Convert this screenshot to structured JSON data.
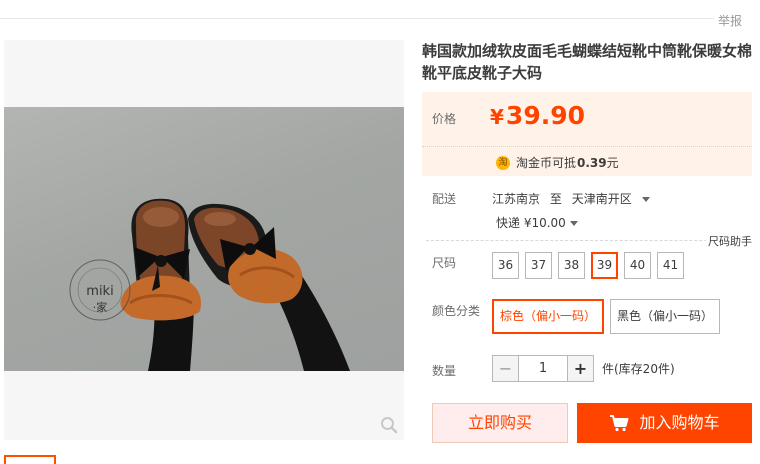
{
  "report_label": "举报",
  "product": {
    "title": "韩国款加绒软皮面毛毛蝴蝶结短靴中筒靴保暖女棉靴平底皮靴子大码",
    "watermark_text": "miki·家"
  },
  "price": {
    "label": "价格",
    "currency": "¥",
    "value": "39.90",
    "coin_icon_text": "淘",
    "coin_text": "淘金币可抵",
    "coin_amount": "0.39",
    "coin_unit": "元"
  },
  "shipping": {
    "label": "配送",
    "from": "江苏南京",
    "to_word": "至",
    "destination": "天津南开区",
    "express": "快递 ¥10.00"
  },
  "size": {
    "helper": "尺码助手",
    "label": "尺码",
    "options": [
      "36",
      "37",
      "38",
      "39",
      "40",
      "41"
    ],
    "selected": "39"
  },
  "color": {
    "label": "颜色分类",
    "options": [
      "棕色（偏小一码）",
      "黑色（偏小一码）"
    ],
    "selected": "棕色（偏小一码）"
  },
  "quantity": {
    "label": "数量",
    "minus": "−",
    "plus": "+",
    "value": "1",
    "stock_text": "件(库存20件)"
  },
  "actions": {
    "buy_now": "立即购买",
    "add_cart": "加入购物车"
  },
  "colors": {
    "accent": "#ff4400",
    "price_bg": "#fff2e8"
  }
}
